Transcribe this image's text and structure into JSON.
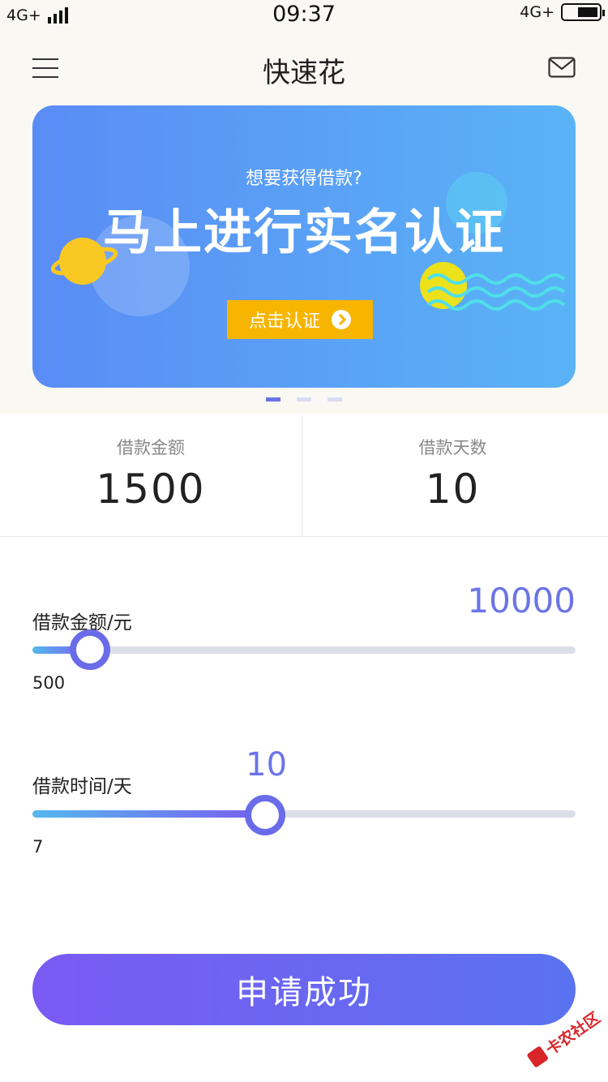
{
  "status_bar": {
    "network_left": "4G+",
    "time": "09:37",
    "network_right": "4G+"
  },
  "header": {
    "title": "快速花",
    "menu_icon": "hamburger-menu-icon",
    "mail_icon": "mail-icon"
  },
  "banner": {
    "subtitle": "想要获得借款?",
    "headline": "马上进行实名认证",
    "cta_label": "点击认证",
    "colors": {
      "gradient_start": "#5a8cf5",
      "gradient_end": "#5ab3f6",
      "cta": "#f7b500"
    },
    "pagination": {
      "total": 3,
      "active_index": 0
    }
  },
  "summary": {
    "amount_label": "借款金额",
    "amount_value": "1500",
    "days_label": "借款天数",
    "days_value": "10"
  },
  "amount_slider": {
    "label": "借款金额/元",
    "min": "500",
    "max": "10000",
    "value": 1500
  },
  "days_slider": {
    "label": "借款时间/天",
    "min": "7",
    "max": 14,
    "current": "10",
    "value": 10
  },
  "submit": {
    "label": "申请成功"
  },
  "watermark": {
    "text": "卡农社区"
  },
  "colors": {
    "accent": "#6b74e6",
    "button_start": "#7a5af3",
    "button_end": "#5a73f0"
  }
}
